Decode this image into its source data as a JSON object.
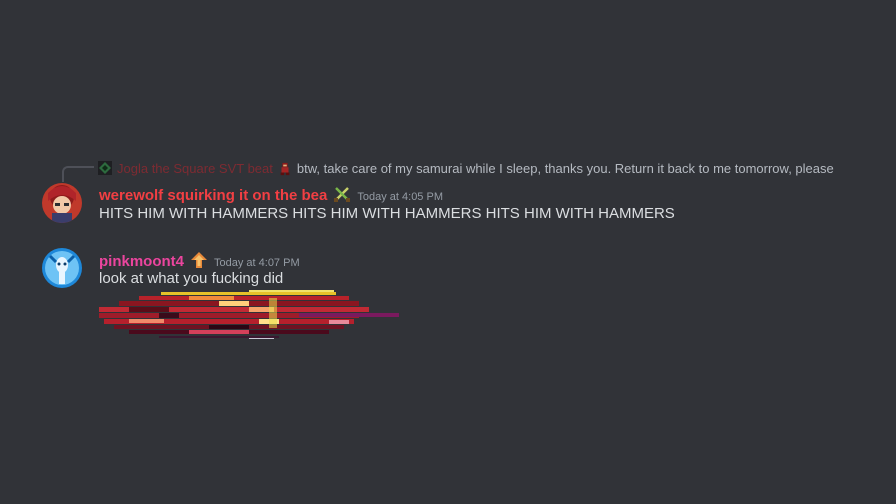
{
  "messages": [
    {
      "reply": {
        "author": "Jogla the Square SVT beat",
        "text": "btw, take care of my samurai while I sleep, thanks you. Return it back to me tomorrow, please"
      },
      "author": "werewolf squirking it on the bea",
      "author_color": "#f23f43",
      "badge_icon": "crossed-swords-icon",
      "timestamp": "Today at 4:05 PM",
      "text": "HITS HIM WITH HAMMERS HITS HIM WITH HAMMERS HITS HIM WITH HAMMERS",
      "avatar_icon": "red-haired-character-avatar"
    },
    {
      "author": "pinkmoont4",
      "author_color": "#eb459e",
      "badge_icon": "arrow-up-sign-icon",
      "timestamp": "Today at 4:07 PM",
      "text": "look at what you fucking did",
      "avatar_icon": "blue-character-avatar",
      "attachment": "glitched-red-pixel-image"
    }
  ],
  "colors": {
    "background": "#313338",
    "text": "#dbdee1",
    "muted": "#949ba4",
    "reply_author": "#7d2b32"
  }
}
